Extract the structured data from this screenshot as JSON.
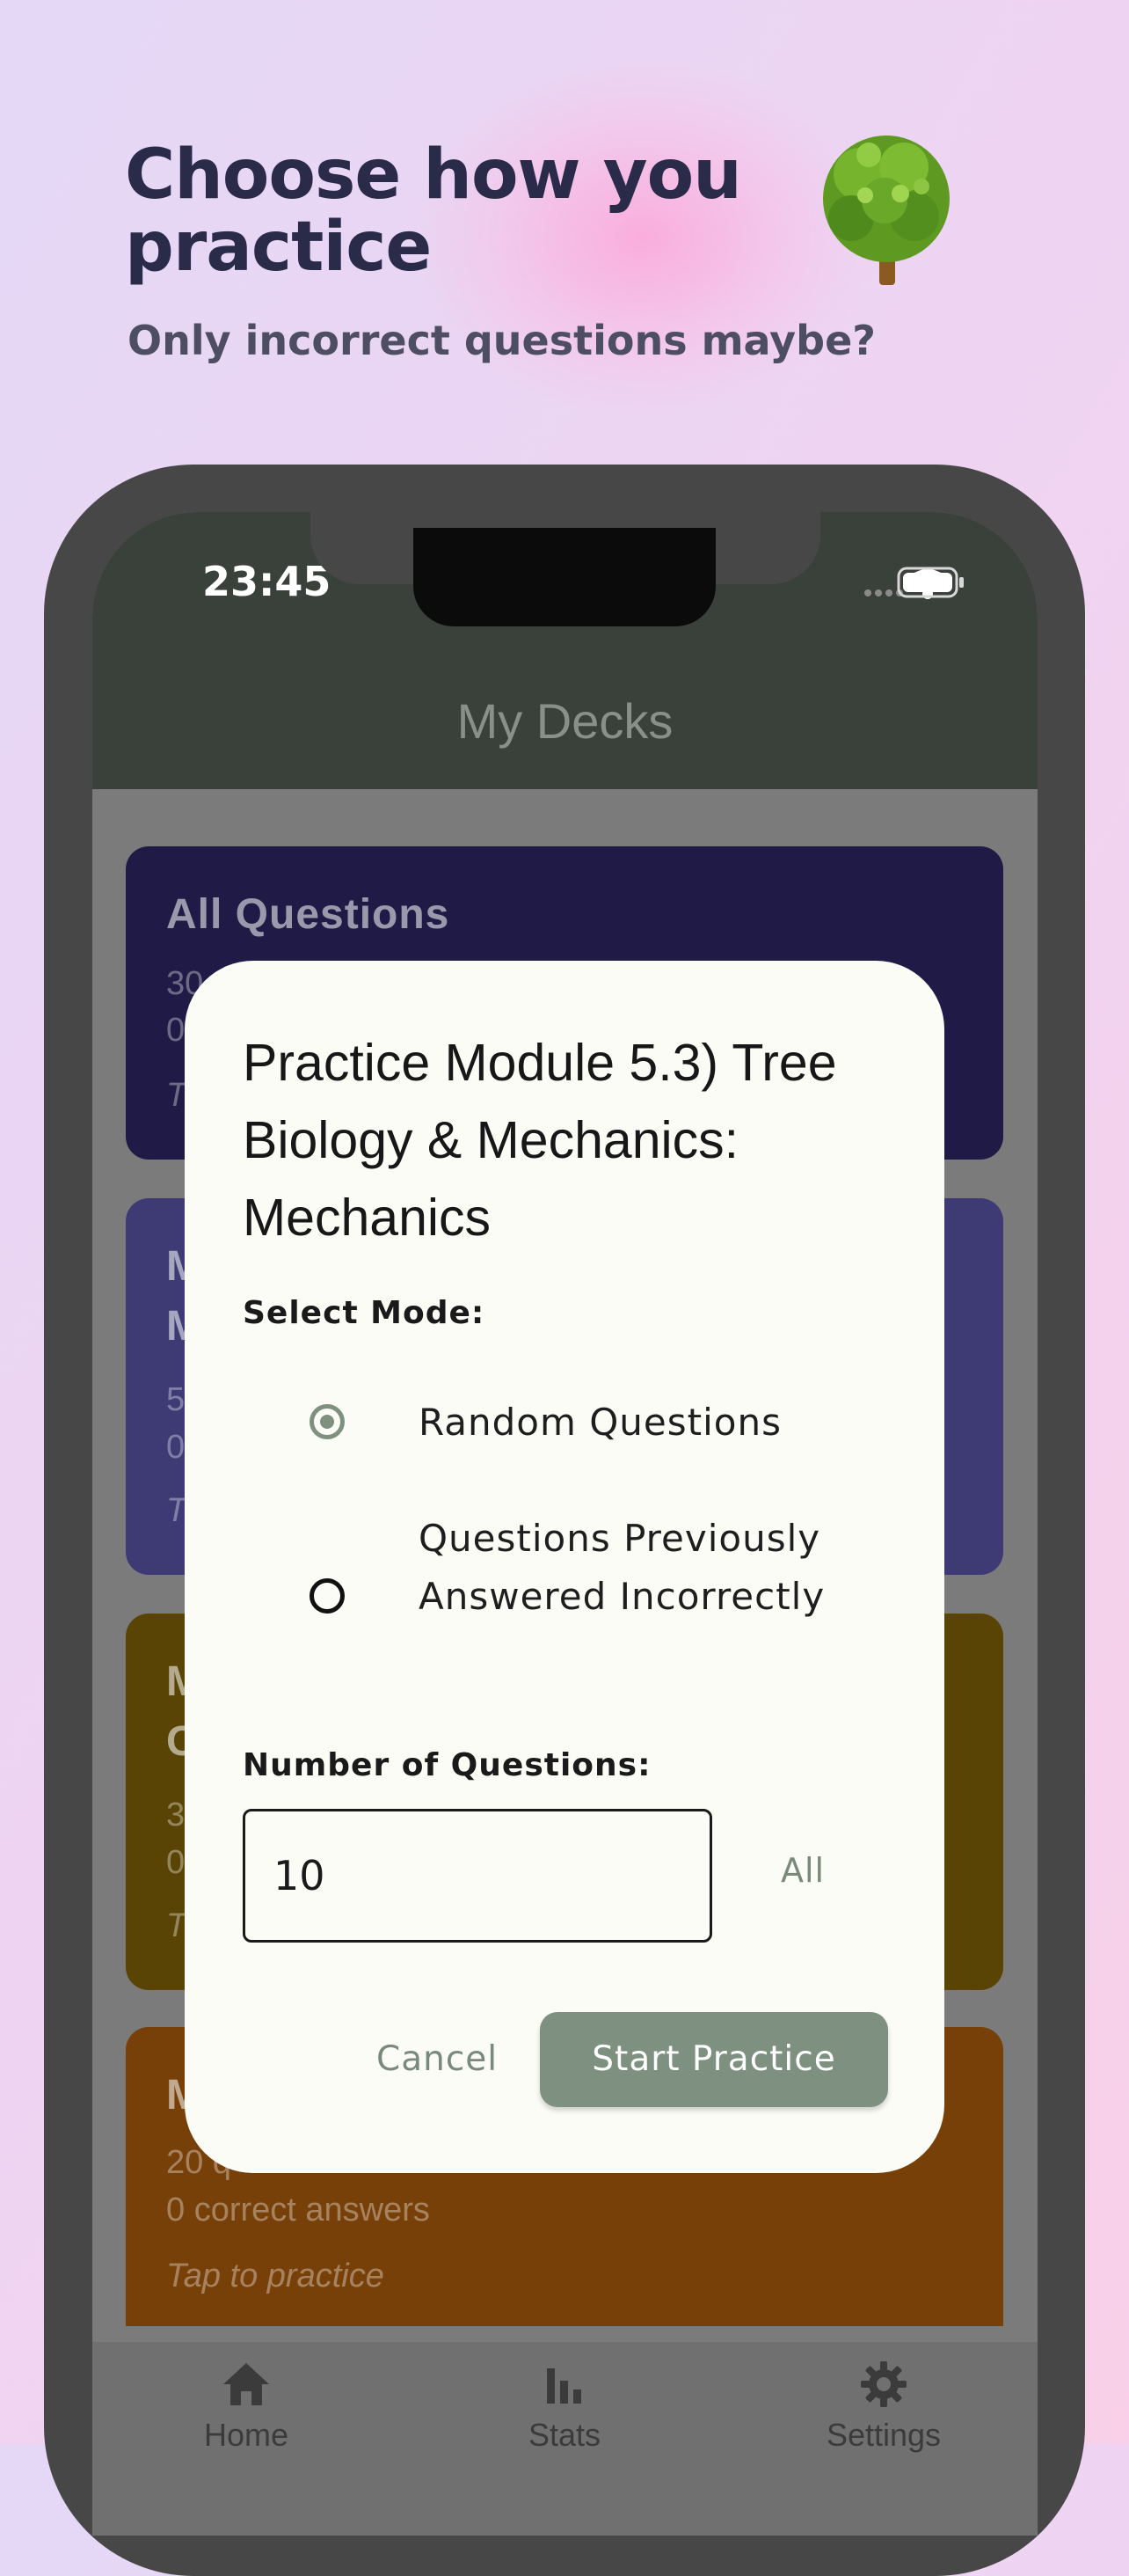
{
  "promo": {
    "headline": "Choose how you practice",
    "subhead": "Only incorrect questions maybe?",
    "icon": "tree-emoji"
  },
  "status_bar": {
    "time": "23:45",
    "icons": [
      "cellular-dots-icon",
      "wifi-icon",
      "battery-icon"
    ]
  },
  "app": {
    "title": "My Decks",
    "decks": [
      {
        "title": "All Questions",
        "line1": "30",
        "line2": "0",
        "tap": "T",
        "color": "#201b46"
      },
      {
        "title": "M",
        "title2": "M",
        "line1": "5",
        "line2": "0",
        "tap": "T",
        "color": "#3d3a74"
      },
      {
        "title": "M",
        "title2": "C",
        "line1": "3",
        "line2": "0",
        "tap": "T",
        "color": "#5a4405"
      },
      {
        "title": "M",
        "line1": "20 q",
        "line2": "0 correct answers",
        "tap": "Tap to practice",
        "color": "#774008"
      }
    ],
    "nav": [
      {
        "label": "Home",
        "icon": "home-icon"
      },
      {
        "label": "Stats",
        "icon": "bar-chart-icon"
      },
      {
        "label": "Settings",
        "icon": "gear-icon"
      }
    ]
  },
  "dialog": {
    "title": "Practice Module 5.3) Tree Biology & Mechanics: Mechanics",
    "select_mode_label": "Select Mode:",
    "options": [
      {
        "label": "Random Questions",
        "selected": true
      },
      {
        "label": "Questions Previously Answered Incorrectly",
        "selected": false
      }
    ],
    "number_label": "Number of Questions:",
    "number_value": "10",
    "all_label": "All",
    "cancel_label": "Cancel",
    "start_label": "Start Practice"
  },
  "colors": {
    "accent": "#7e907f",
    "headline": "#2a2b48",
    "dialog_bg": "#fcfcf7"
  }
}
